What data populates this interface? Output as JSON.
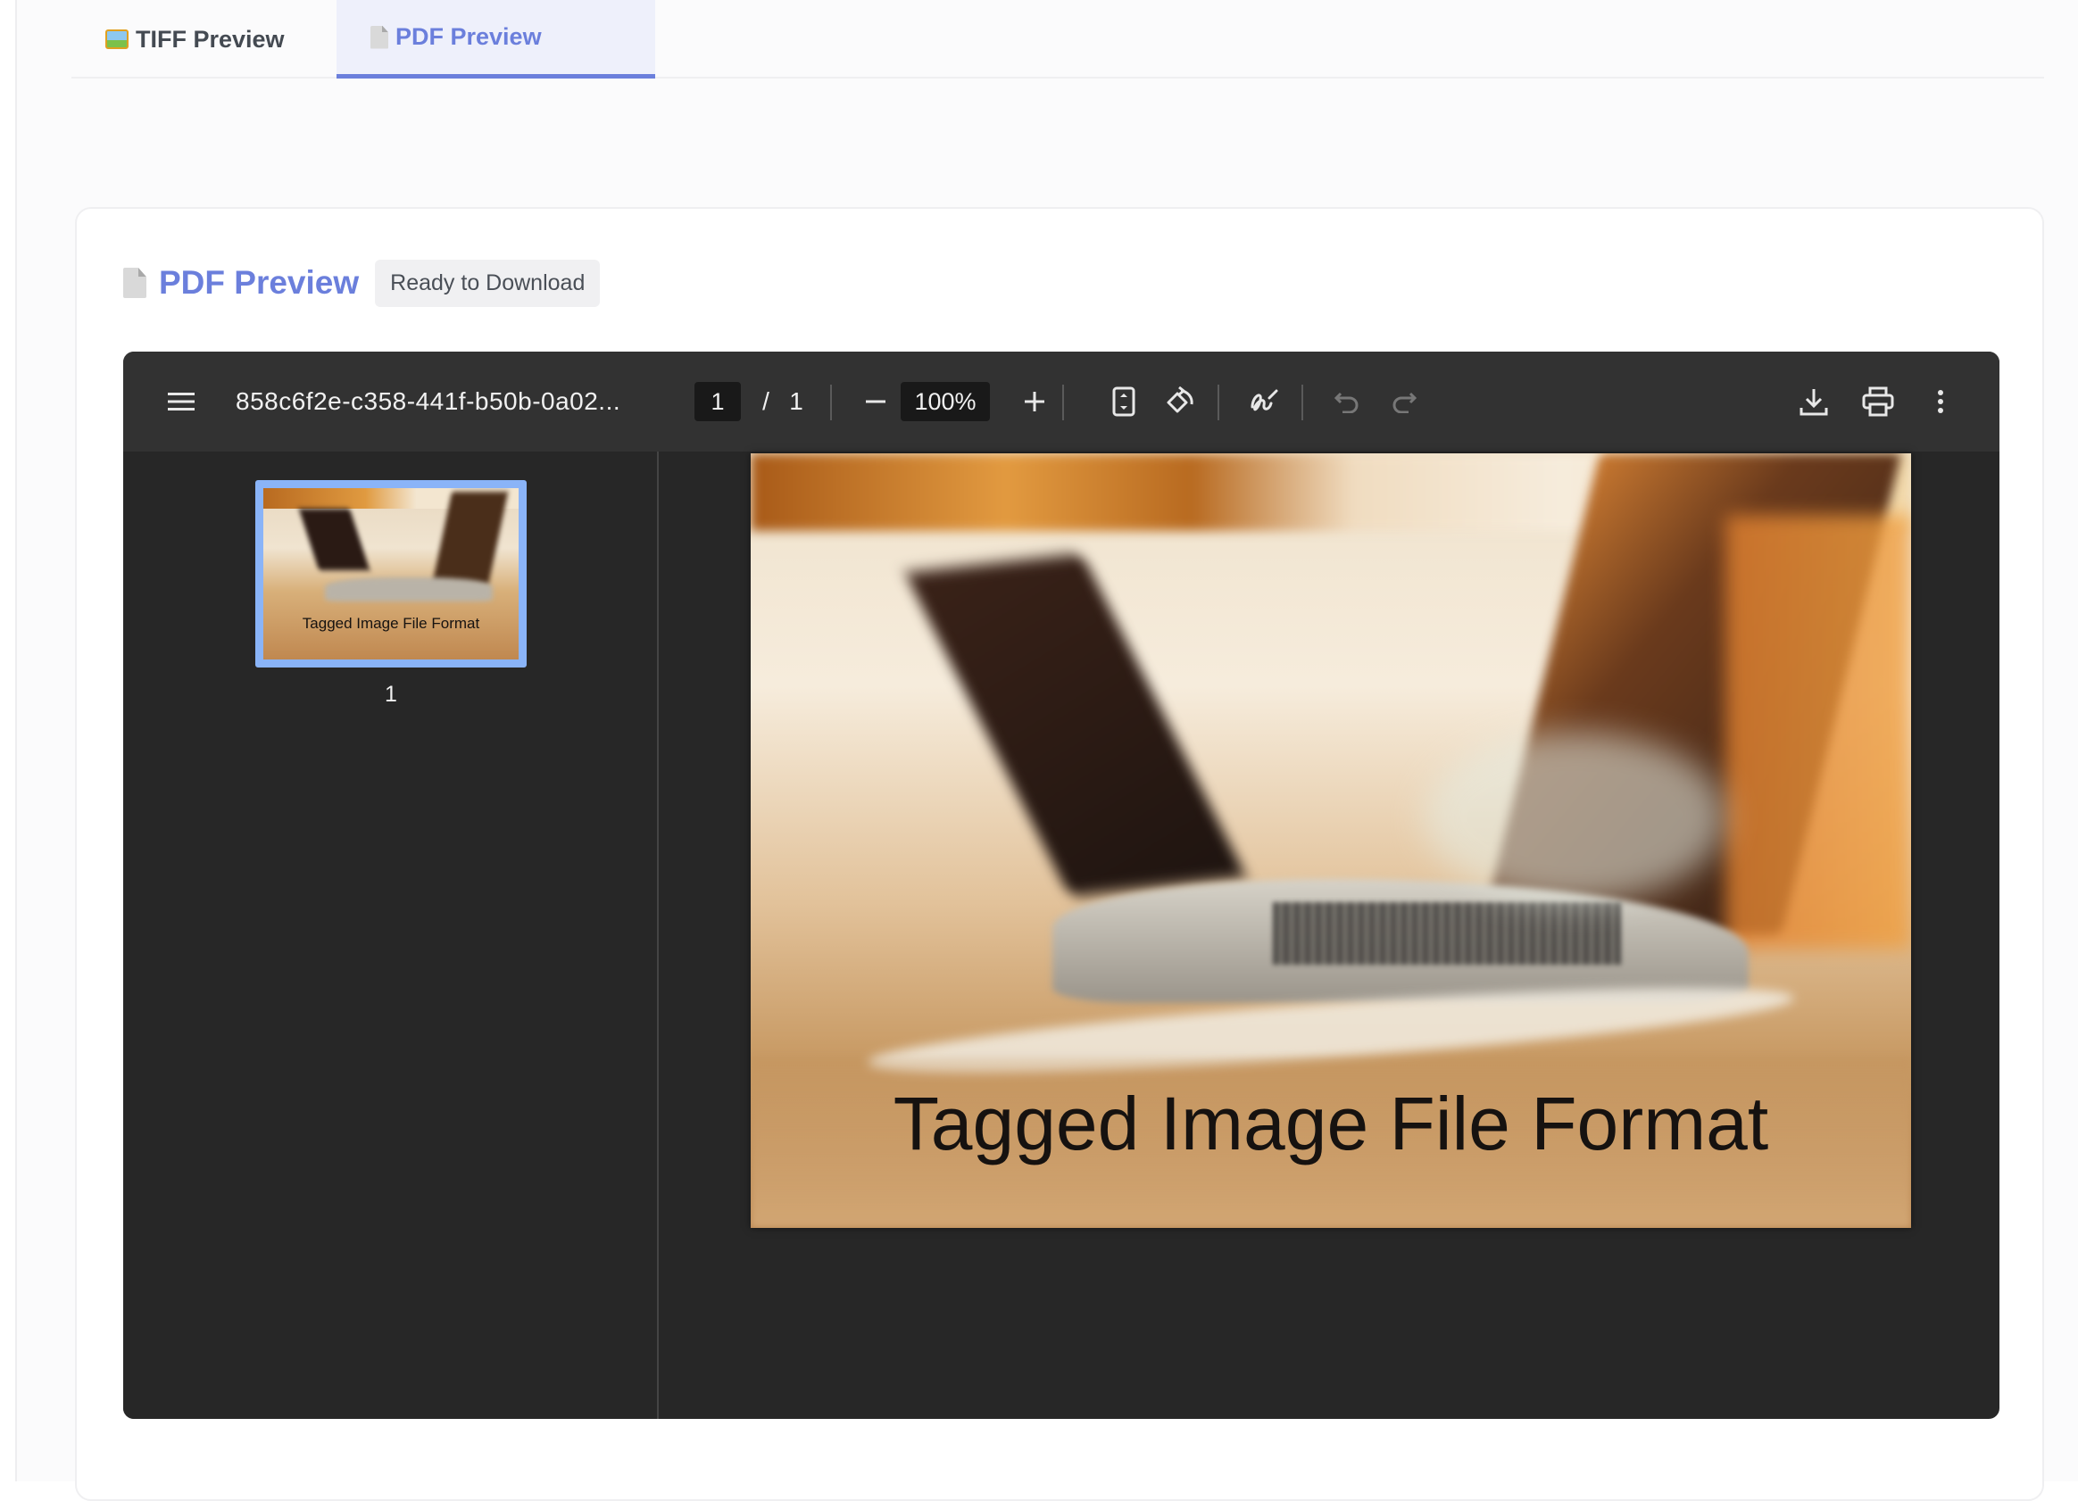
{
  "tabs": [
    {
      "label": "TIFF Preview",
      "icon": "image-icon",
      "active": false
    },
    {
      "label": "PDF Preview",
      "icon": "document-icon",
      "active": true
    }
  ],
  "card": {
    "title": "PDF Preview",
    "badge": "Ready to Download"
  },
  "viewer": {
    "filename": "858c6f2e-c358-441f-b50b-0a02...",
    "current_page": "1",
    "page_separator": "/",
    "total_pages": "1",
    "zoom": "100%",
    "thumbnails": [
      {
        "page_label": "1",
        "caption": "Tagged Image File Format"
      }
    ],
    "page_caption": "Tagged Image File Format"
  },
  "colors": {
    "accent": "#6b7fdc",
    "viewer_bg": "#272727",
    "toolbar_bg": "#323232",
    "thumb_highlight": "#8ab4f8"
  }
}
